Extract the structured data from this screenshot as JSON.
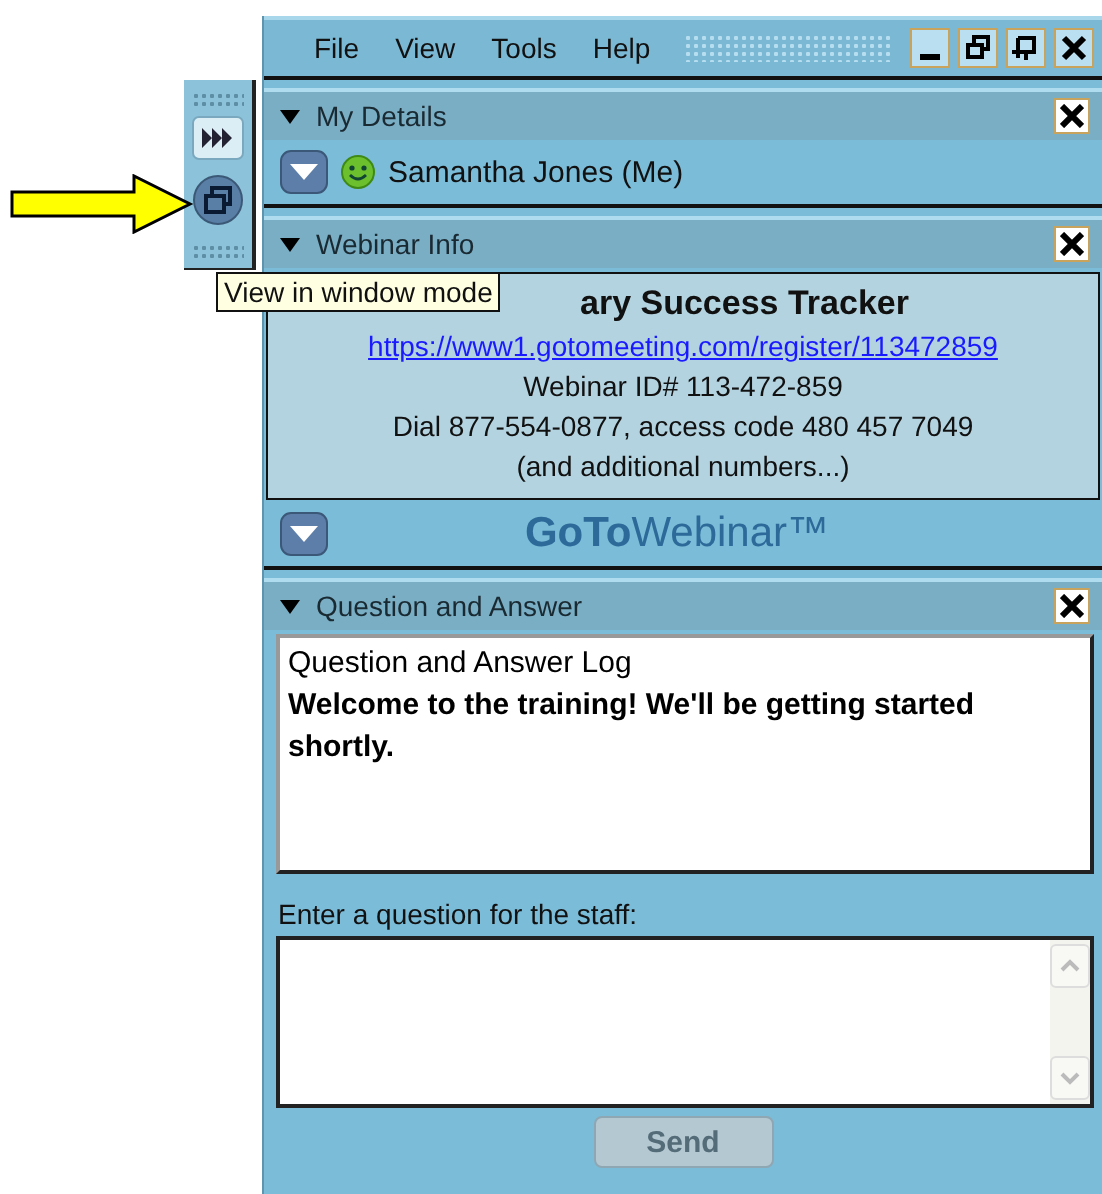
{
  "menu": [
    {
      "label": "File"
    },
    {
      "label": "View"
    },
    {
      "label": "Tools"
    },
    {
      "label": "Help"
    }
  ],
  "side_toolbar": {
    "tooltip": "View in window mode"
  },
  "my_details": {
    "title": "My Details",
    "user": "Samantha Jones (Me)"
  },
  "webinar_info": {
    "title": "Webinar Info",
    "webinar_name": "ary Success Tracker",
    "link": "https://www1.gotomeeting.com/register/113472859",
    "webinar_id": "Webinar ID# 113-472-859",
    "dial": "Dial 877-554-0877, access code 480 457 7049",
    "more": "(and additional numbers...)",
    "brand": "**GoTo**Webinar™"
  },
  "question_and_answer": {
    "title": "Question and Answer",
    "log_heading": "Question and Answer Log",
    "log_message": "Welcome to the training! We'll be getting started shortly.",
    "input_label": "Enter a question for the staff:",
    "send_button": {
      "label": "Send",
      "disabled": true
    }
  }
}
